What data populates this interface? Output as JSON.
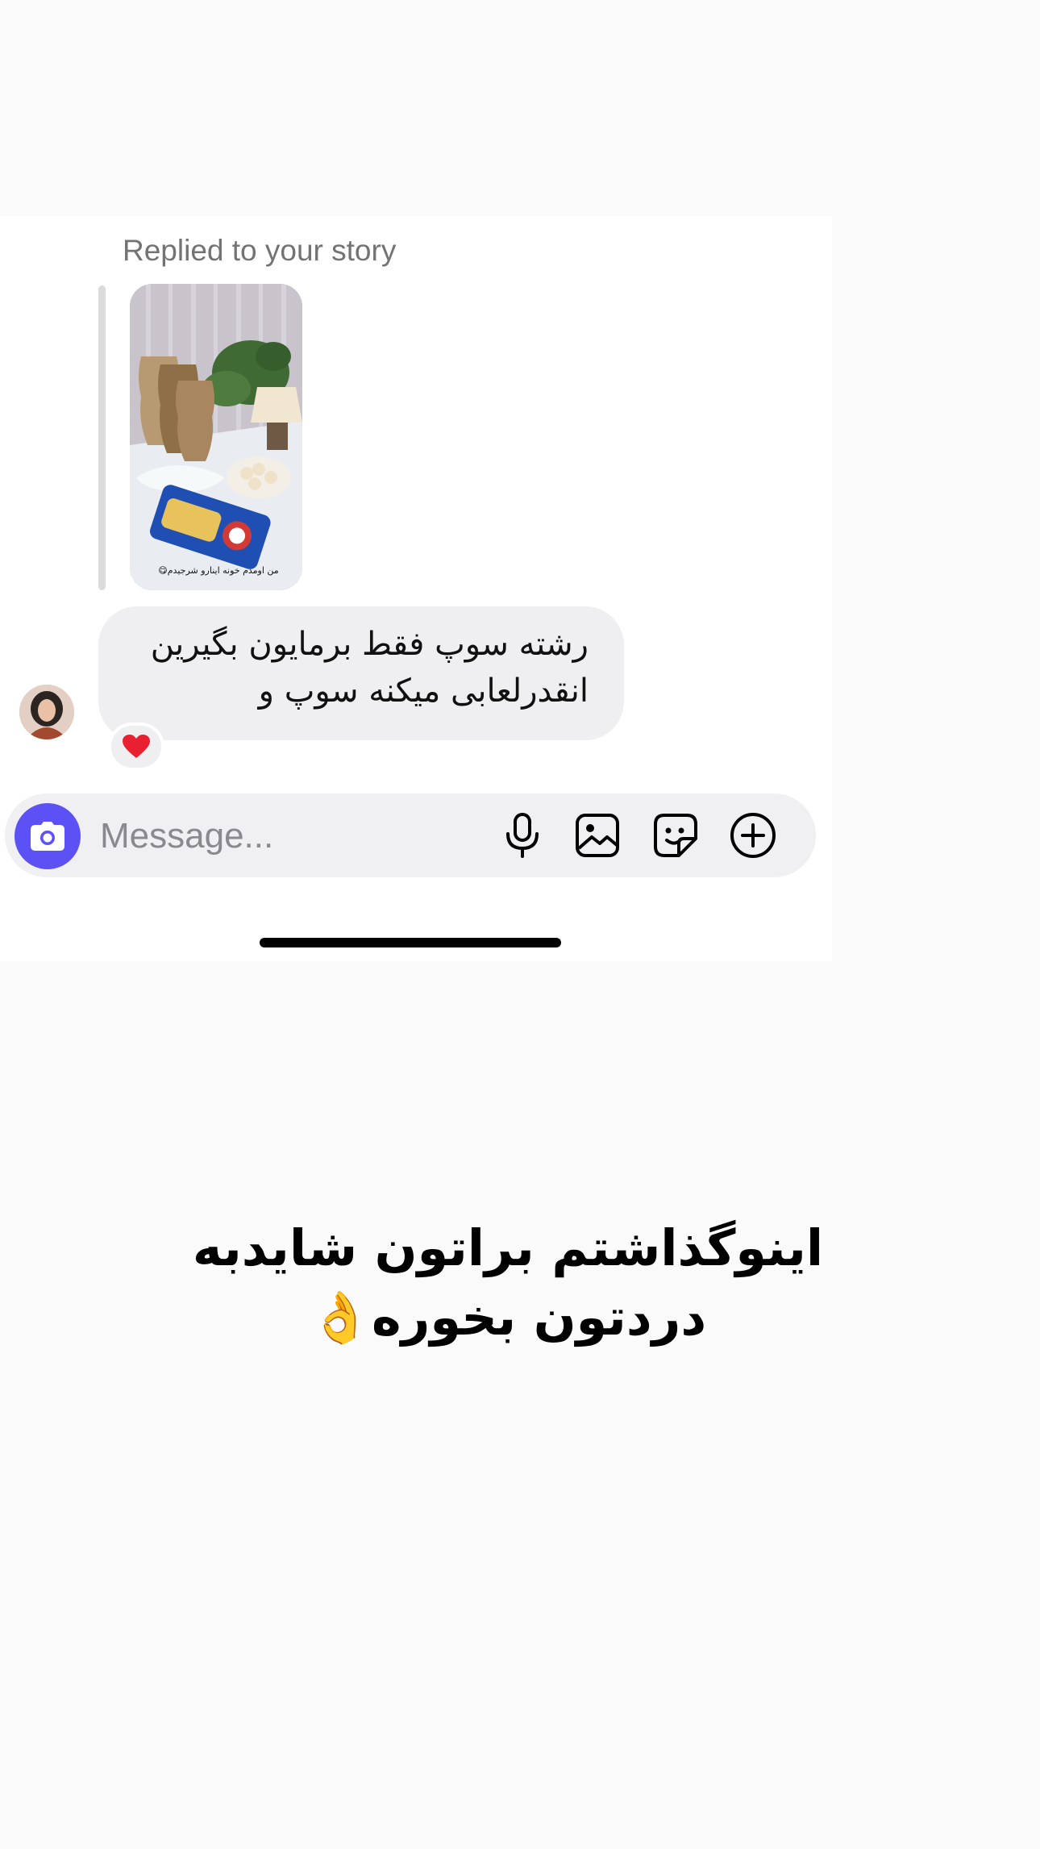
{
  "story_reply": {
    "label": "Replied to your story",
    "story_caption": "من اومدم خونه اینارو شرجیدم😋"
  },
  "message": {
    "text": "رشته سوپ فقط برمایون بگیرین انقدرلعابی میکنه سوپ و",
    "reaction": "❤️"
  },
  "composer": {
    "placeholder": "Message...",
    "camera_icon": "camera-icon",
    "tools": [
      "microphone-icon",
      "gallery-icon",
      "sticker-icon",
      "plus-icon"
    ]
  },
  "overlay": {
    "text": "اینوگذاشتم براتون شایدبه دردتون بخوره👌"
  },
  "colors": {
    "accent": "#5b51f5",
    "bubble": "#efeff1",
    "page_background": "#fafafa"
  }
}
